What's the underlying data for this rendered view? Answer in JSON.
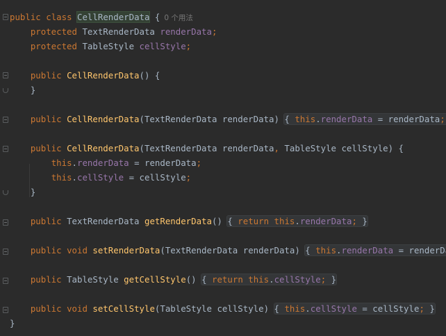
{
  "code": {
    "l1": {
      "kw1": "public",
      "kw2": "class",
      "class_name": "CellRenderData",
      "brace": "{",
      "hint": "0 个用法"
    },
    "l2": {
      "kw": "protected",
      "type": "TextRenderData",
      "field": "renderData",
      "semi": ";"
    },
    "l3": {
      "kw": "protected",
      "type": "TableStyle",
      "field": "cellStyle",
      "semi": ";"
    },
    "l5": {
      "kw": "public",
      "name": "CellRenderData",
      "rest": "() {"
    },
    "l6": {
      "text": "}"
    },
    "l8": {
      "kw": "public",
      "name": "CellRenderData",
      "params": "(TextRenderData renderData)",
      "open": "{",
      "this": "this",
      "field": "renderData",
      "assign": " = renderData",
      "semi": ";",
      "close": "}"
    },
    "l10": {
      "kw": "public",
      "name": "CellRenderData",
      "params_a": "(TextRenderData renderData",
      "comma": ",",
      "params_b": " TableStyle cellStyle) {"
    },
    "l11": {
      "this": "this",
      "field": "renderData",
      "assign": " = renderData",
      "semi": ";"
    },
    "l12": {
      "this": "this",
      "field": "cellStyle",
      "assign": " = cellStyle",
      "semi": ";"
    },
    "l13": {
      "text": "}"
    },
    "l15": {
      "kw": "public",
      "type": "TextRenderData",
      "name": "getRenderData",
      "parens": "()",
      "open": "{",
      "ret": "return",
      "this": "this",
      "field": "renderData",
      "semi": ";",
      "close": "}"
    },
    "l17": {
      "kw1": "public",
      "kw2": "void",
      "name": "setRenderData",
      "params": "(TextRenderData renderData)",
      "open": "{",
      "this": "this",
      "field": "renderData",
      "assign": " = renderData",
      "semi": ";",
      "close": "}"
    },
    "l19": {
      "kw": "public",
      "type": "TableStyle",
      "name": "getCellStyle",
      "parens": "()",
      "open": "{",
      "ret": "return",
      "this": "this",
      "field": "cellStyle",
      "semi": ";",
      "close": "}"
    },
    "l21": {
      "kw1": "public",
      "kw2": "void",
      "name": "setCellStyle",
      "params": "(TableStyle cellStyle)",
      "open": "{",
      "this": "this",
      "field": "cellStyle",
      "assign": " = cellStyle",
      "semi": ";",
      "close": "}"
    },
    "l22": {
      "text": "}"
    }
  },
  "colors": {
    "background": "#2b2b2b",
    "keyword": "#cc7832",
    "method": "#ffc66d",
    "field": "#9876aa",
    "text": "#a9b7c6",
    "hint": "#787878"
  }
}
